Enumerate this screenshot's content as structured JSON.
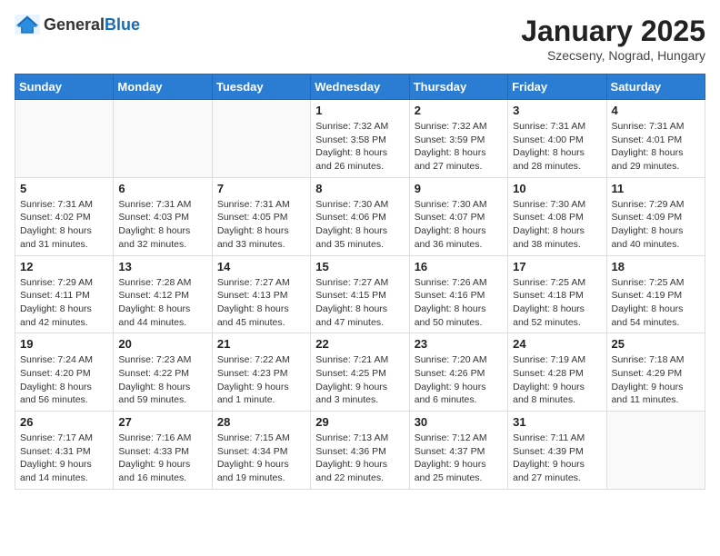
{
  "header": {
    "logo_general": "General",
    "logo_blue": "Blue",
    "month_title": "January 2025",
    "location": "Szecseny, Nograd, Hungary"
  },
  "weekdays": [
    "Sunday",
    "Monday",
    "Tuesday",
    "Wednesday",
    "Thursday",
    "Friday",
    "Saturday"
  ],
  "weeks": [
    [
      {
        "day": "",
        "info": ""
      },
      {
        "day": "",
        "info": ""
      },
      {
        "day": "",
        "info": ""
      },
      {
        "day": "1",
        "info": "Sunrise: 7:32 AM\nSunset: 3:58 PM\nDaylight: 8 hours and 26 minutes."
      },
      {
        "day": "2",
        "info": "Sunrise: 7:32 AM\nSunset: 3:59 PM\nDaylight: 8 hours and 27 minutes."
      },
      {
        "day": "3",
        "info": "Sunrise: 7:31 AM\nSunset: 4:00 PM\nDaylight: 8 hours and 28 minutes."
      },
      {
        "day": "4",
        "info": "Sunrise: 7:31 AM\nSunset: 4:01 PM\nDaylight: 8 hours and 29 minutes."
      }
    ],
    [
      {
        "day": "5",
        "info": "Sunrise: 7:31 AM\nSunset: 4:02 PM\nDaylight: 8 hours and 31 minutes."
      },
      {
        "day": "6",
        "info": "Sunrise: 7:31 AM\nSunset: 4:03 PM\nDaylight: 8 hours and 32 minutes."
      },
      {
        "day": "7",
        "info": "Sunrise: 7:31 AM\nSunset: 4:05 PM\nDaylight: 8 hours and 33 minutes."
      },
      {
        "day": "8",
        "info": "Sunrise: 7:30 AM\nSunset: 4:06 PM\nDaylight: 8 hours and 35 minutes."
      },
      {
        "day": "9",
        "info": "Sunrise: 7:30 AM\nSunset: 4:07 PM\nDaylight: 8 hours and 36 minutes."
      },
      {
        "day": "10",
        "info": "Sunrise: 7:30 AM\nSunset: 4:08 PM\nDaylight: 8 hours and 38 minutes."
      },
      {
        "day": "11",
        "info": "Sunrise: 7:29 AM\nSunset: 4:09 PM\nDaylight: 8 hours and 40 minutes."
      }
    ],
    [
      {
        "day": "12",
        "info": "Sunrise: 7:29 AM\nSunset: 4:11 PM\nDaylight: 8 hours and 42 minutes."
      },
      {
        "day": "13",
        "info": "Sunrise: 7:28 AM\nSunset: 4:12 PM\nDaylight: 8 hours and 44 minutes."
      },
      {
        "day": "14",
        "info": "Sunrise: 7:27 AM\nSunset: 4:13 PM\nDaylight: 8 hours and 45 minutes."
      },
      {
        "day": "15",
        "info": "Sunrise: 7:27 AM\nSunset: 4:15 PM\nDaylight: 8 hours and 47 minutes."
      },
      {
        "day": "16",
        "info": "Sunrise: 7:26 AM\nSunset: 4:16 PM\nDaylight: 8 hours and 50 minutes."
      },
      {
        "day": "17",
        "info": "Sunrise: 7:25 AM\nSunset: 4:18 PM\nDaylight: 8 hours and 52 minutes."
      },
      {
        "day": "18",
        "info": "Sunrise: 7:25 AM\nSunset: 4:19 PM\nDaylight: 8 hours and 54 minutes."
      }
    ],
    [
      {
        "day": "19",
        "info": "Sunrise: 7:24 AM\nSunset: 4:20 PM\nDaylight: 8 hours and 56 minutes."
      },
      {
        "day": "20",
        "info": "Sunrise: 7:23 AM\nSunset: 4:22 PM\nDaylight: 8 hours and 59 minutes."
      },
      {
        "day": "21",
        "info": "Sunrise: 7:22 AM\nSunset: 4:23 PM\nDaylight: 9 hours and 1 minute."
      },
      {
        "day": "22",
        "info": "Sunrise: 7:21 AM\nSunset: 4:25 PM\nDaylight: 9 hours and 3 minutes."
      },
      {
        "day": "23",
        "info": "Sunrise: 7:20 AM\nSunset: 4:26 PM\nDaylight: 9 hours and 6 minutes."
      },
      {
        "day": "24",
        "info": "Sunrise: 7:19 AM\nSunset: 4:28 PM\nDaylight: 9 hours and 8 minutes."
      },
      {
        "day": "25",
        "info": "Sunrise: 7:18 AM\nSunset: 4:29 PM\nDaylight: 9 hours and 11 minutes."
      }
    ],
    [
      {
        "day": "26",
        "info": "Sunrise: 7:17 AM\nSunset: 4:31 PM\nDaylight: 9 hours and 14 minutes."
      },
      {
        "day": "27",
        "info": "Sunrise: 7:16 AM\nSunset: 4:33 PM\nDaylight: 9 hours and 16 minutes."
      },
      {
        "day": "28",
        "info": "Sunrise: 7:15 AM\nSunset: 4:34 PM\nDaylight: 9 hours and 19 minutes."
      },
      {
        "day": "29",
        "info": "Sunrise: 7:13 AM\nSunset: 4:36 PM\nDaylight: 9 hours and 22 minutes."
      },
      {
        "day": "30",
        "info": "Sunrise: 7:12 AM\nSunset: 4:37 PM\nDaylight: 9 hours and 25 minutes."
      },
      {
        "day": "31",
        "info": "Sunrise: 7:11 AM\nSunset: 4:39 PM\nDaylight: 9 hours and 27 minutes."
      },
      {
        "day": "",
        "info": ""
      }
    ]
  ]
}
